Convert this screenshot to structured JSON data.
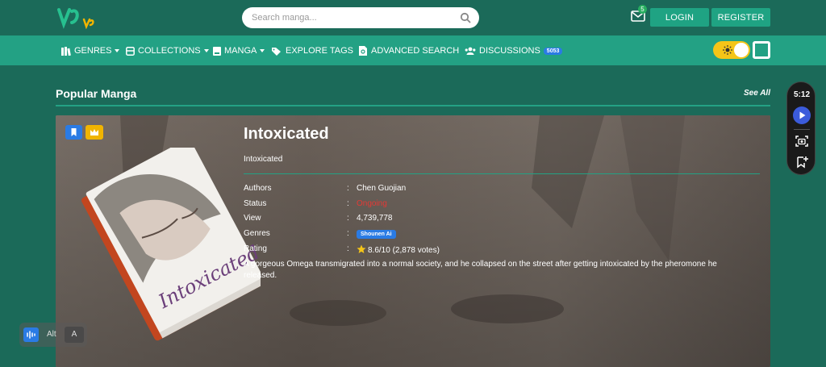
{
  "header": {
    "search_placeholder": "Search manga...",
    "mail_count": "5",
    "login_label": "LOGIN",
    "register_label": "REGISTER"
  },
  "nav": {
    "genres": "GENRES",
    "collections": "COLLECTIONS",
    "manga": "MANGA",
    "explore_tags": "EXPLORE TAGS",
    "advanced_search": "ADVANCED SEARCH",
    "discussions": "DISCUSSIONS",
    "discussions_count": "5053"
  },
  "section": {
    "title": "Popular Manga",
    "see_all": "See All"
  },
  "manga": {
    "title": "Intoxicated",
    "alt_title": "Intoxicated",
    "cover_text": "Intoxicated",
    "authors_label": "Authors",
    "authors_value": "Chen Guojian",
    "status_label": "Status",
    "status_value": "Ongoing",
    "view_label": "View",
    "view_value": "4,739,778",
    "genres_label": "Genres",
    "genre_tag": "Shounen Ai",
    "rating_label": "Rating",
    "rating_value": "8.6/10 (2,878 votes)",
    "colon": ":",
    "synopsis": "A gorgeous Omega transmigrated into a normal society, and he collapsed on the street after getting intoxicated by the pheromone he released."
  },
  "sidepanel": {
    "time": "5:12"
  },
  "a11y": {
    "alt_label": "Alt",
    "a_label": "A"
  },
  "colors": {
    "background": "#1b6a59",
    "navbar": "#23a184",
    "button": "#1fa383",
    "badge_blue": "#2a7be4",
    "status_red": "#e53935",
    "toggle_yellow": "#f5c518"
  }
}
